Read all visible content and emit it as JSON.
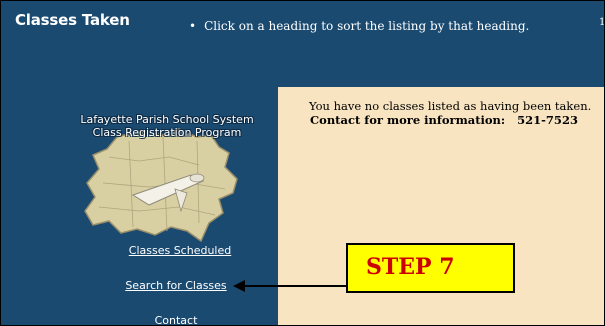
{
  "header": {
    "title": "Classes Taken",
    "instruction": "Click on a heading to sort the listing by that heading.",
    "corner_number": "1"
  },
  "sidebar": {
    "org_line_1": "Lafayette Parish School System",
    "org_line_2": "Class Registration Program",
    "nav": [
      {
        "label": "Classes Scheduled"
      },
      {
        "label": "Search for Classes"
      },
      {
        "label": "Contact"
      }
    ]
  },
  "main": {
    "message": "You have no classes listed as having been taken.",
    "contact_label": "Contact for more information:",
    "contact_phone": "521-7523"
  },
  "callout": {
    "label": "STEP 7",
    "text_color": "#cc0000",
    "background": "#ffff00"
  },
  "colors": {
    "header_bg": "#1b4a71",
    "content_bg": "#f8e4c0"
  }
}
